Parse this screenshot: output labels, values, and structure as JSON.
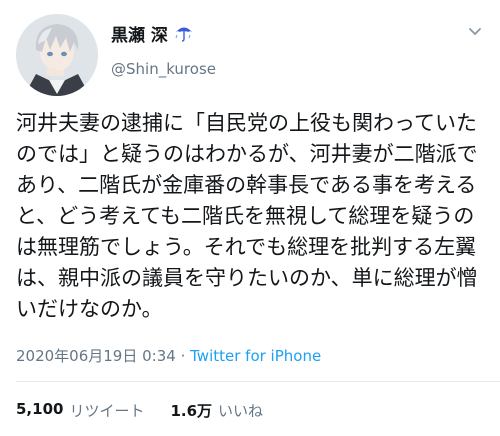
{
  "user": {
    "display_name": "黒瀬 深",
    "handle": "@Shin_kurose",
    "name_emoji_icon": "umbrella-with-rain-icon"
  },
  "tweet": {
    "text": "河井夫妻の逮捕に「自民党の上役も関わっていたのでは」と疑うのはわかるが、河井妻が二階派であり、二階氏が金庫番の幹事長である事を考えると、どう考えても二階氏を無視して総理を疑うのは無理筋でしょう。それでも総理を批判する左翼は、親中派の議員を守りたいのか、単に総理が憎いだけなのか。",
    "timestamp": "2020年06月19日 0:34",
    "separator": " · ",
    "source": "Twitter for iPhone"
  },
  "stats": {
    "retweets_count": "5,100",
    "retweets_label": "リツイート",
    "likes_count": "1.6万",
    "likes_label": "いいね"
  },
  "colors": {
    "text": "#14171a",
    "secondary": "#657786",
    "accent": "#1da1f2",
    "divider": "#e6ecf0"
  }
}
